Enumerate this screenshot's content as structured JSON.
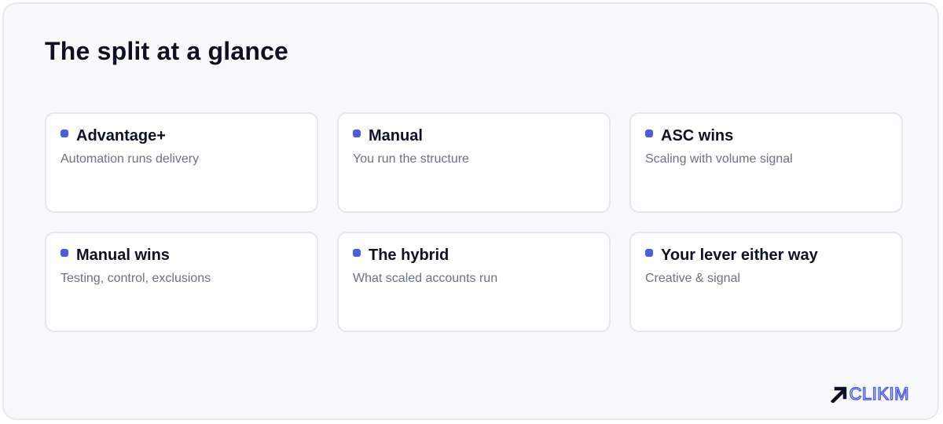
{
  "header": {
    "title": "The split at a glance"
  },
  "cards": [
    {
      "title": "Advantage+",
      "subtitle": "Automation runs delivery"
    },
    {
      "title": "Manual",
      "subtitle": "You run the structure"
    },
    {
      "title": "ASC wins",
      "subtitle": "Scaling with volume signal"
    },
    {
      "title": "Manual wins",
      "subtitle": "Testing, control, exclusions"
    },
    {
      "title": "The hybrid",
      "subtitle": "What scaled accounts run"
    },
    {
      "title": "Your lever either way",
      "subtitle": "Creative & signal"
    }
  ],
  "brand": {
    "logo_text": "CLIKIM",
    "accent_color": "#4b5be8",
    "icon": "arrow-up-right-icon"
  }
}
